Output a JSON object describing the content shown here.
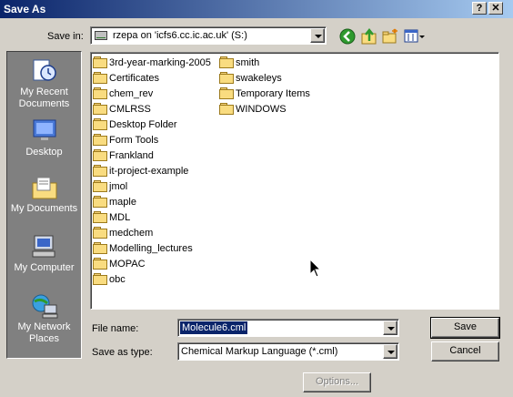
{
  "window": {
    "title": "Save As",
    "help_label": "?",
    "close_label": "✕"
  },
  "save_in": {
    "label": "Save in:",
    "value": "rzepa on 'icfs6.cc.ic.ac.uk' (S:)"
  },
  "toolbar": {
    "icons": [
      "back-icon",
      "up-folder-icon",
      "new-folder-icon",
      "views-menu-icon"
    ]
  },
  "places": [
    {
      "label": "My Recent Documents",
      "icon": "recent-documents-icon"
    },
    {
      "label": "Desktop",
      "icon": "desktop-icon"
    },
    {
      "label": "My Documents",
      "icon": "my-documents-icon"
    },
    {
      "label": "My Computer",
      "icon": "my-computer-icon"
    },
    {
      "label": "My Network Places",
      "icon": "network-places-icon"
    }
  ],
  "files": {
    "column1": [
      "3rd-year-marking-2005",
      "Certificates",
      "chem_rev",
      "CMLRSS",
      "Desktop Folder",
      "Form Tools",
      "Frankland",
      "it-project-example",
      "jmol",
      "maple",
      "MDL",
      "medchem",
      "Modelling_lectures",
      "MOPAC",
      "obc"
    ],
    "column2": [
      "smith",
      "swakeleys",
      "Temporary Items",
      "WINDOWS"
    ]
  },
  "file_name": {
    "label": "File name:",
    "value": "Molecule6.cml"
  },
  "save_as_type": {
    "label": "Save as type:",
    "value": "Chemical Markup Language (*.cml)"
  },
  "buttons": {
    "save": "Save",
    "cancel": "Cancel",
    "options": "Options..."
  },
  "colors": {
    "title_start": "#0a246a",
    "title_end": "#a6caf0",
    "face": "#d4d0c8",
    "places_bg": "#808080",
    "selection": "#0a246a"
  }
}
